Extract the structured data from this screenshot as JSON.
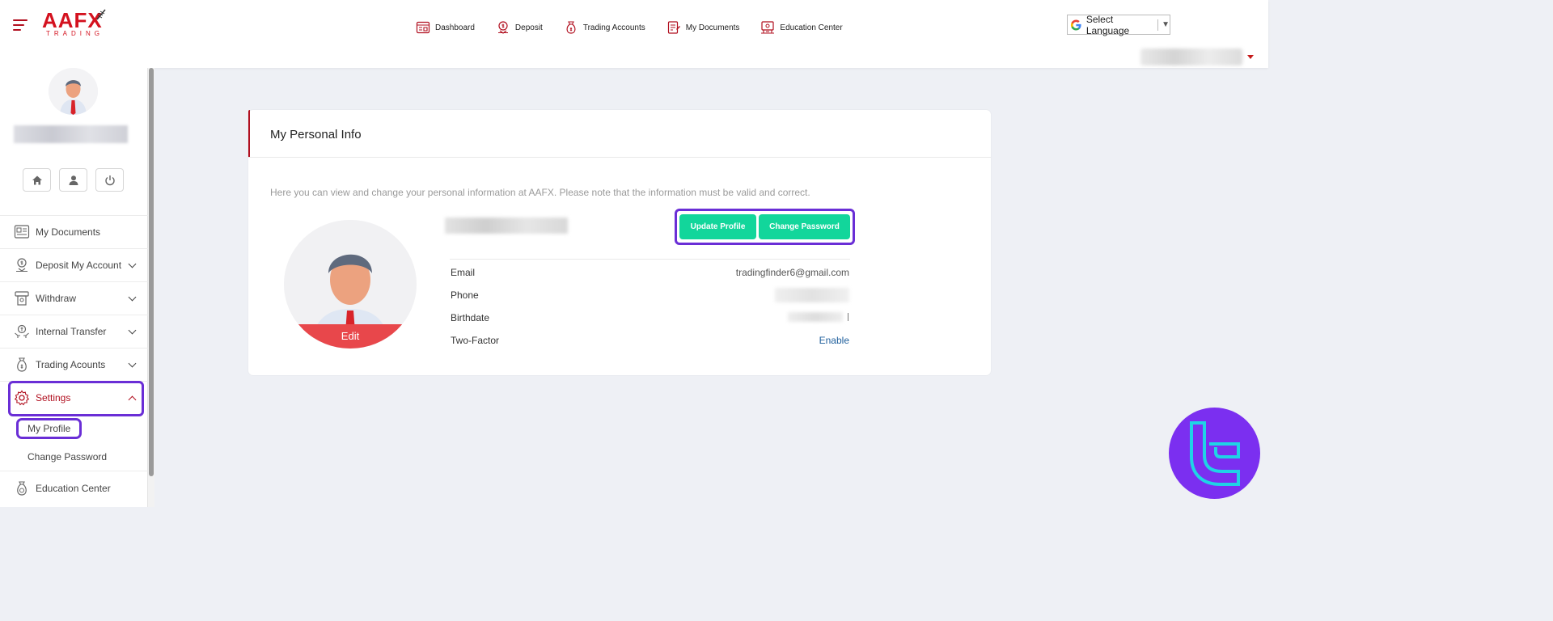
{
  "brand": {
    "name": "AAFX",
    "sub": "TRADING"
  },
  "topnav": [
    {
      "label": "Dashboard",
      "icon": "dashboard-icon"
    },
    {
      "label": "Deposit",
      "icon": "deposit-icon"
    },
    {
      "label": "Trading Accounts",
      "icon": "money-bag-icon"
    },
    {
      "label": "My Documents",
      "icon": "documents-icon"
    },
    {
      "label": "Education Center",
      "icon": "education-icon"
    }
  ],
  "language": {
    "label": "Select Language",
    "arrow": "▼"
  },
  "sidebar": {
    "items": [
      {
        "label": "My Documents",
        "icon": "documents-icon",
        "chevron": false
      },
      {
        "label": "Deposit My Account",
        "icon": "deposit-icon",
        "chevron": true
      },
      {
        "label": "Withdraw",
        "icon": "withdraw-icon",
        "chevron": true
      },
      {
        "label": "Internal Transfer",
        "icon": "transfer-icon",
        "chevron": true
      },
      {
        "label": "Trading Acounts",
        "icon": "money-bag-icon",
        "chevron": true
      },
      {
        "label": "Settings",
        "icon": "gear-icon",
        "chevron": true,
        "active": true
      },
      {
        "label": "Education Center",
        "icon": "education-icon",
        "chevron": false
      }
    ],
    "settings_sub": [
      {
        "label": "My Profile"
      },
      {
        "label": "Change Password"
      }
    ]
  },
  "card": {
    "title": "My Personal Info",
    "description": "Here you can view and change your personal information at AAFX. Please note that the information must be valid and correct.",
    "edit_label": "Edit",
    "buttons": {
      "update_profile": "Update Profile",
      "change_password": "Change Password"
    },
    "fields": {
      "email": {
        "label": "Email",
        "value": "tradingfinder6@gmail.com"
      },
      "phone": {
        "label": "Phone"
      },
      "birthdate": {
        "label": "Birthdate"
      },
      "two_factor": {
        "label": "Two-Factor",
        "value": "Enable"
      }
    }
  },
  "colors": {
    "brand_red": "#d4121f",
    "accent_green": "#12d69b",
    "highlight_purple": "#6a2ed6",
    "link_blue": "#1f5f9c"
  }
}
